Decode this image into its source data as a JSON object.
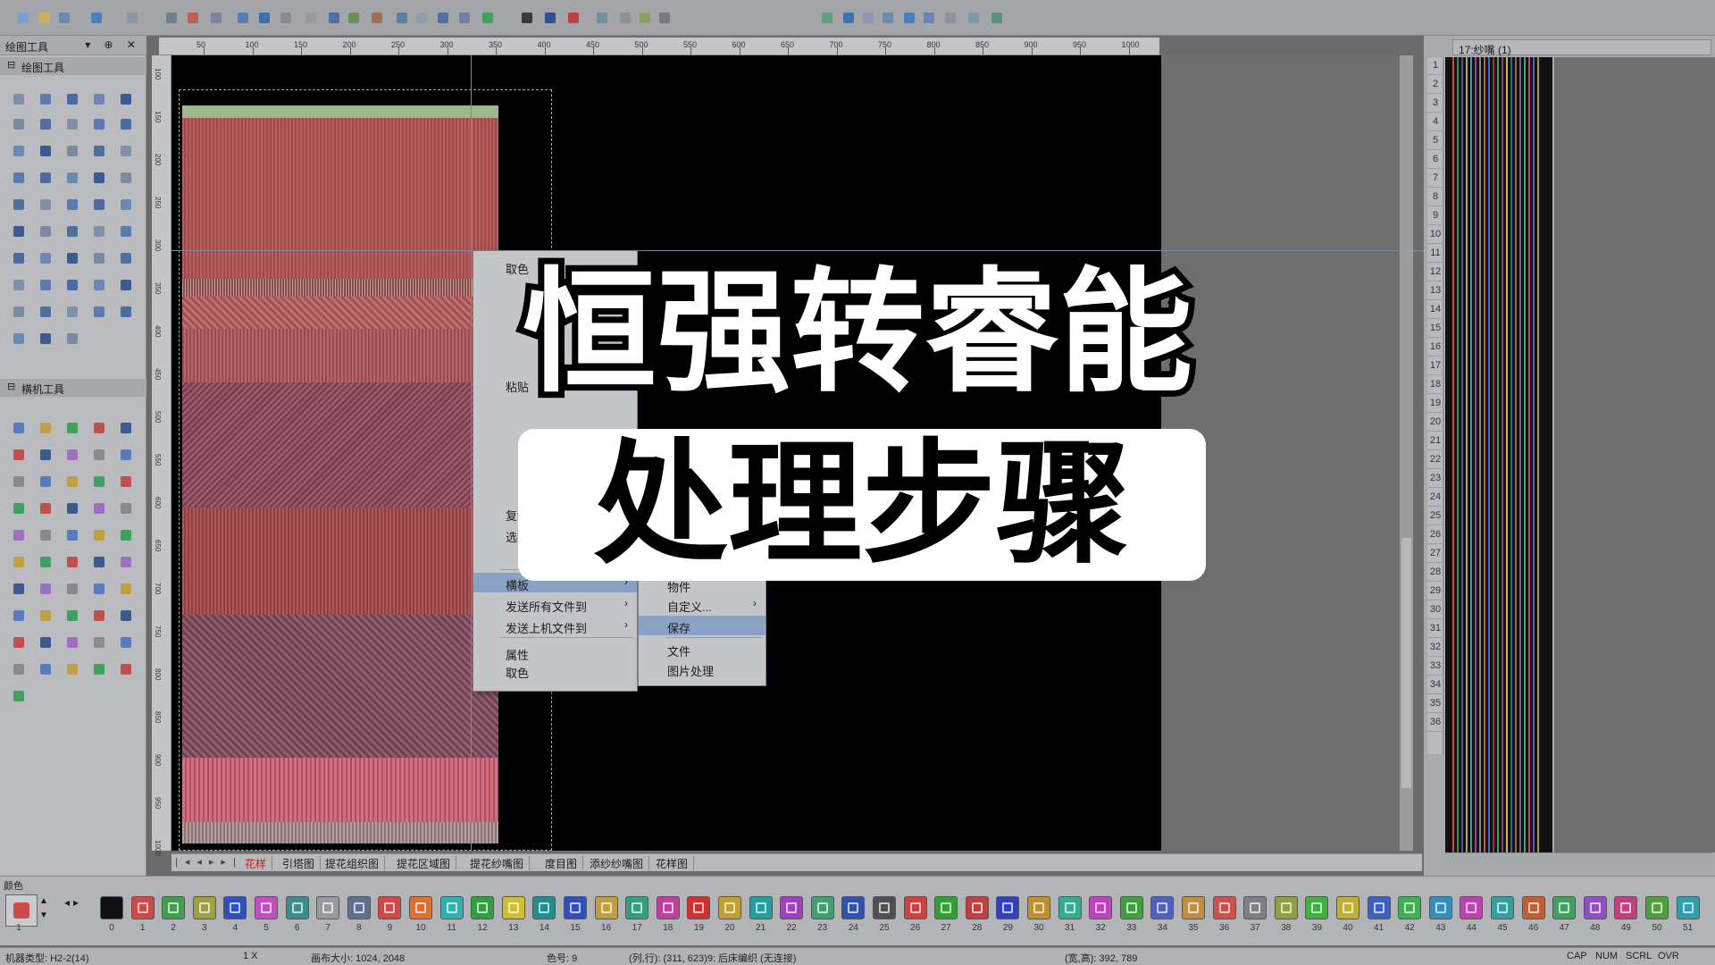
{
  "left_panel": {
    "title": "绘图工具",
    "title_buttons": "▾ ⊕ ✕",
    "group1": "绘图工具",
    "group2": "横机工具"
  },
  "ruler_top": [
    "50",
    "100",
    "150",
    "200",
    "250",
    "300",
    "350",
    "400",
    "450",
    "500",
    "550",
    "600",
    "650",
    "700",
    "750",
    "800",
    "850",
    "900",
    "950",
    "1000"
  ],
  "ruler_left": [
    "100",
    "150",
    "200",
    "250",
    "300",
    "350",
    "400",
    "450",
    "500",
    "550",
    "600",
    "650",
    "700",
    "750",
    "800",
    "850",
    "900",
    "950",
    "1000",
    "1050"
  ],
  "tabs": [
    "花样",
    "引塔图",
    "提花组织图",
    "提花区域图",
    "提花纱嘴图",
    "度目图",
    "添纱纱嘴图",
    "花样图"
  ],
  "right_panel": {
    "title": "17:纱嘴 (1)",
    "rows": [
      "1",
      "2",
      "3",
      "4",
      "5",
      "6",
      "7",
      "8",
      "9",
      "10",
      "11",
      "12",
      "13",
      "14",
      "15",
      "16",
      "17",
      "18",
      "19",
      "20",
      "21",
      "22",
      "23",
      "24",
      "25",
      "26",
      "27",
      "28",
      "29",
      "30",
      "31",
      "32",
      "33",
      "34",
      "35",
      "36"
    ]
  },
  "context_menu": {
    "items": [
      {
        "label": "取色"
      },
      {
        "label": "粘贴"
      },
      {
        "label": "复制"
      },
      {
        "label": "选择"
      },
      {
        "label": "横板",
        "sub": true
      },
      {
        "label": "发送所有文件到",
        "sub": true
      },
      {
        "label": "发送上机文件到",
        "sub": true
      },
      {
        "label": "属性"
      },
      {
        "label": "取色"
      }
    ]
  },
  "submenu": {
    "items": [
      {
        "label": "物件"
      },
      {
        "label": "自定义...",
        "sub": true
      },
      {
        "label": "保存"
      },
      {
        "label": "文件"
      },
      {
        "label": "图片处理"
      }
    ]
  },
  "palette": {
    "title": "颜色",
    "selected_index": "1",
    "indices": [
      "0",
      "1",
      "2",
      "3",
      "4",
      "5",
      "6",
      "7",
      "8",
      "9",
      "10",
      "11",
      "12",
      "13",
      "14",
      "15",
      "16",
      "17",
      "18",
      "19",
      "20",
      "21",
      "22",
      "23",
      "24",
      "25",
      "26",
      "27",
      "28",
      "29",
      "30",
      "31",
      "32",
      "33",
      "34",
      "35",
      "36",
      "37",
      "38",
      "39",
      "40",
      "41",
      "42",
      "43",
      "44",
      "45",
      "46",
      "47",
      "48",
      "49",
      "50",
      "51"
    ],
    "colors": [
      "#111111",
      "#d04848",
      "#40a050",
      "#a0a040",
      "#3050c0",
      "#c050c0",
      "#3c8c8c",
      "#9a9a9a",
      "#607090",
      "#d04848",
      "#e07030",
      "#30b0b0",
      "#30a040",
      "#d0c030",
      "#209090",
      "#3050c0",
      "#c0a040",
      "#30a080",
      "#c040a0",
      "#d03030",
      "#c0a030",
      "#20a0a0",
      "#a040c0",
      "#40a070",
      "#3050b0",
      "#505050",
      "#d04040",
      "#30a030",
      "#c04040",
      "#3040c0",
      "#c09030",
      "#30b090",
      "#c040c0",
      "#40a040",
      "#5060c0",
      "#c09040",
      "#d05050",
      "#808080",
      "#90a040",
      "#40b040",
      "#c0b030",
      "#4060c0",
      "#40b050",
      "#3090c0",
      "#c040b0",
      "#30a0a0",
      "#c06030",
      "#40a060",
      "#9050c0",
      "#c04080",
      "#50a040",
      "#30a0b0"
    ]
  },
  "status": {
    "machine": "机器类型: H2-2(14)",
    "zoom": "1 X",
    "canvas_size": "画布大小: 1024, 2048",
    "color_no": "色号: 9",
    "coords": "(列,行): (311, 623)9: 后床编织 (无连接)",
    "size": "(宽,高): 392, 789",
    "cap": "CAP",
    "num": "NUM",
    "scrl": "SCRL",
    "ovr": "OVR"
  },
  "overlay": {
    "line1": "恒强转睿能",
    "line2": "处理步骤"
  }
}
